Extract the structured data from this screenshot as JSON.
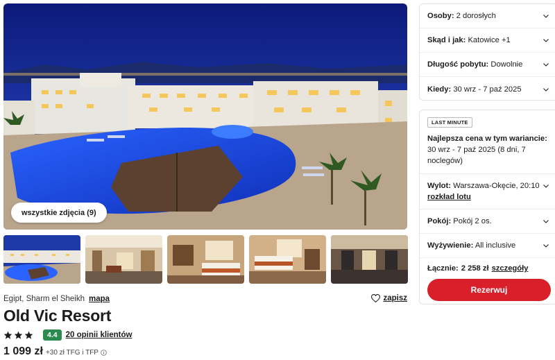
{
  "gallery": {
    "all_photos_label": "wszystkie zdjęcia (9)",
    "thumbnail_count": 5
  },
  "hotel": {
    "location": "Egipt, Sharm el Sheikh",
    "map_label": "mapa",
    "save_label": "zapisz",
    "name": "Old Vic Resort",
    "stars": 3,
    "score": "4.4",
    "reviews_label": "20 opinii klientów",
    "price": "1 099 zł",
    "fees": "+30 zł TFG i TFP"
  },
  "search": {
    "people_label": "Osoby:",
    "people_value": "2 dorosłych",
    "from_label": "Skąd i jak:",
    "from_value": "Katowice +1",
    "length_label": "Długość pobytu:",
    "length_value": "Dowolnie",
    "when_label": "Kiedy:",
    "when_value": "30 wrz - 7 paź 2025"
  },
  "offer": {
    "badge": "LAST MINUTE",
    "best_price_label": "Najlepsza cena w tym wariancie:",
    "best_price_value": "30 wrz - 7 paź 2025 (8 dni, 7 noclegów)",
    "flight_label": "Wylot:",
    "flight_value": "Warszawa-Okęcie, 20:10",
    "flight_schedule_label": "rozkład lotu",
    "room_label": "Pokój:",
    "room_value": "Pokój 2 os.",
    "board_label": "Wyżywienie:",
    "board_value": "All inclusive",
    "total_label": "Łącznie:",
    "total_value": "2 258 zł",
    "details_label": "szczegóły",
    "reserve_label": "Rezerwuj"
  },
  "colors": {
    "accent": "#d81f2a",
    "score_bg": "#2d8a4e",
    "night_sky": "#1a2f8a",
    "pool": "#1f4fd8"
  }
}
